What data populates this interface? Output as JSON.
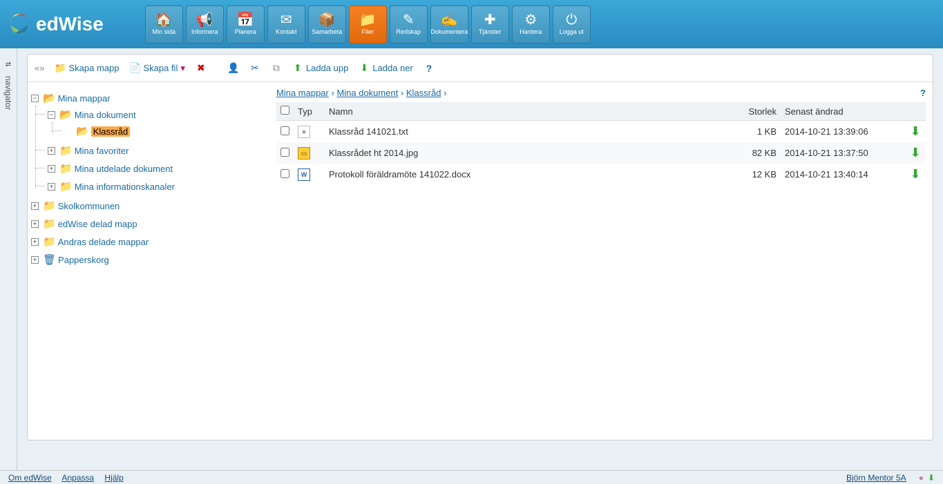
{
  "logo_text": "edWise",
  "nav": [
    {
      "label": "Min sida",
      "icon": "🏠"
    },
    {
      "label": "Informera",
      "icon": "📢"
    },
    {
      "label": "Planera",
      "icon": "📅"
    },
    {
      "label": "Kontakt",
      "icon": "✉"
    },
    {
      "label": "Samarbeta",
      "icon": "📦"
    },
    {
      "label": "Filer",
      "icon": "📁",
      "active": true
    },
    {
      "label": "Redskap",
      "icon": "✎"
    },
    {
      "label": "Dokumentera",
      "icon": "✍"
    },
    {
      "label": "Tjänster",
      "icon": "✚"
    },
    {
      "label": "Hantera",
      "icon": "⚙"
    },
    {
      "label": "Logga ut",
      "icon": "⏻"
    }
  ],
  "navigator_label": "navigator",
  "toolbar": {
    "nav_toggle": "«»",
    "skapa_mapp": "Skapa mapp",
    "skapa_fil": "Skapa fil",
    "ladda_upp": "Ladda upp",
    "ladda_ner": "Ladda ner"
  },
  "tree": {
    "root": "Mina mappar",
    "mina_dokument": "Mina dokument",
    "klassrad": "Klassråd",
    "mina_favoriter": "Mina favoriter",
    "mina_utdelade": "Mina utdelade dokument",
    "mina_info": "Mina informationskanaler",
    "skolkommunen": "Skolkommunen",
    "edwise_delad": "edWise delad mapp",
    "andras_delade": "Andras delade mappar",
    "papperskorg": "Papperskorg"
  },
  "breadcrumb": {
    "p1": "Mina mappar",
    "p2": "Mina dokument",
    "p3": "Klassråd",
    "sep": " › "
  },
  "columns": {
    "typ": "Typ",
    "namn": "Namn",
    "storlek": "Storlek",
    "senast": "Senast ändrad"
  },
  "files": [
    {
      "type": "txt",
      "name": "Klassråd 141021.txt",
      "size": "1 KB",
      "date": "2014-10-21 13:39:06"
    },
    {
      "type": "img",
      "name": "Klassrådet ht 2014.jpg",
      "size": "82 KB",
      "date": "2014-10-21 13:37:50"
    },
    {
      "type": "doc",
      "name": "Protokoll föräldramöte 141022.docx",
      "size": "12 KB",
      "date": "2014-10-21 13:40:14"
    }
  ],
  "footer": {
    "om": "Om edWise",
    "anpassa": "Anpassa",
    "hjalp": "Hjälp",
    "user": "Björn Mentor 5A"
  }
}
